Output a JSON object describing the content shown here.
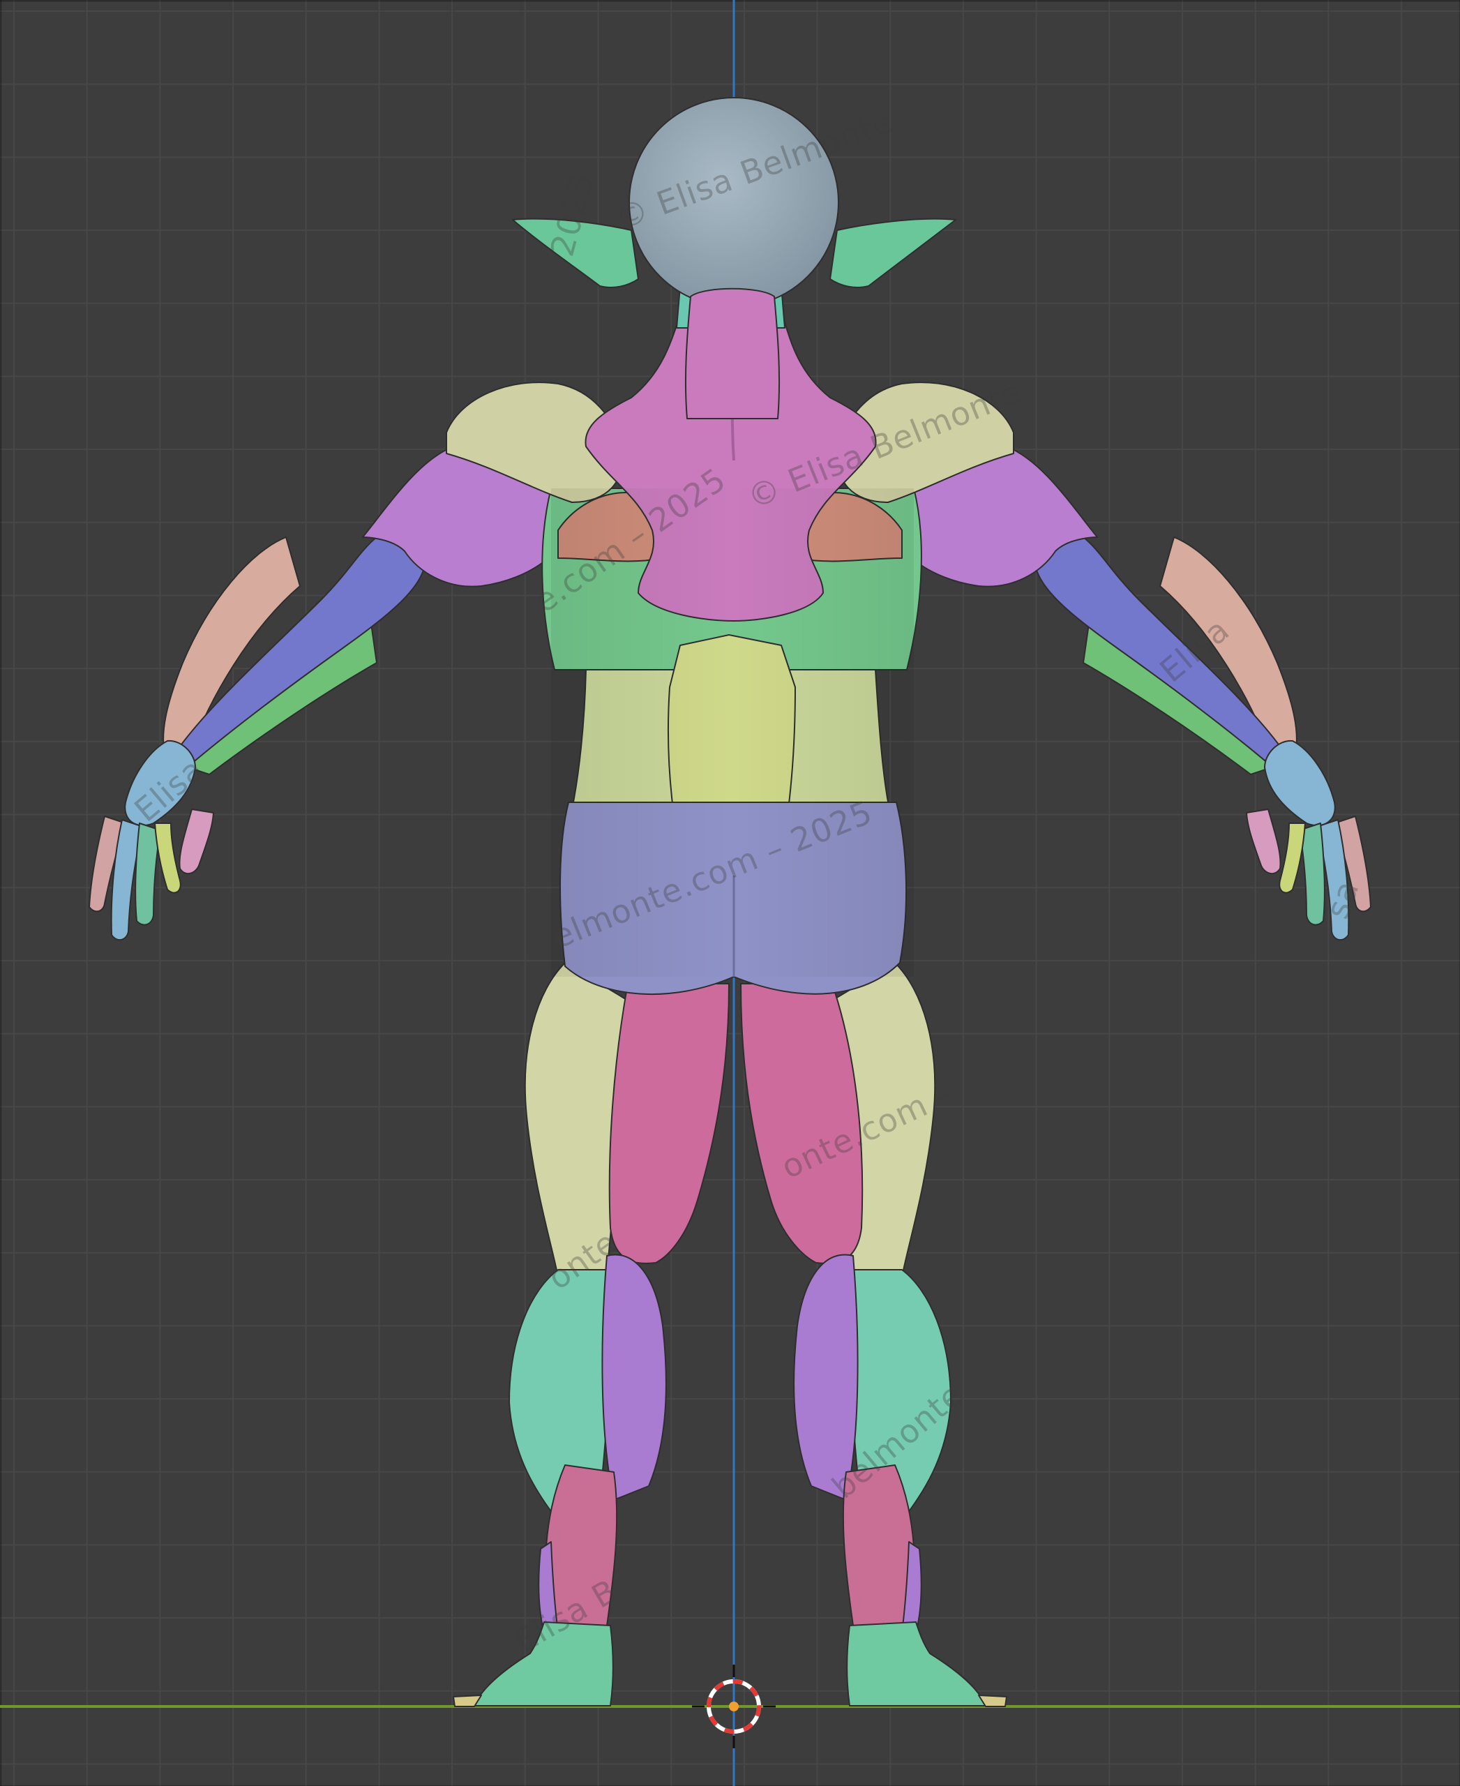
{
  "viewport": {
    "view": "back-orthographic",
    "background_color": "#3d3d3d",
    "grid_color": "#474747",
    "z_axis_color": "#2f77c9",
    "x_axis_color": "#6f9a2a",
    "cursor_colors": [
      "#e53935",
      "#ffffff"
    ]
  },
  "model": {
    "parts": [
      {
        "name": "head",
        "color": "#8fa2b0"
      },
      {
        "name": "ears",
        "color": "#6ac79a"
      },
      {
        "name": "trapezius",
        "color": "#c97bbd"
      },
      {
        "name": "shoulders",
        "color": "#cfd0a3"
      },
      {
        "name": "upper-arms",
        "color": "#b97ecf"
      },
      {
        "name": "forearms",
        "color": "#7478cc"
      },
      {
        "name": "forearm-outer",
        "color": "#d8ab9f"
      },
      {
        "name": "forearm-inner",
        "color": "#6fc177"
      },
      {
        "name": "scapula",
        "color": "#cf8d7a"
      },
      {
        "name": "latissimus",
        "color": "#74c88d"
      },
      {
        "name": "lower-back",
        "color": "#c9d79a"
      },
      {
        "name": "spine-center",
        "color": "#cfd98a"
      },
      {
        "name": "glutes",
        "color": "#8f92c7"
      },
      {
        "name": "outer-thighs",
        "color": "#d2d6a6"
      },
      {
        "name": "hamstrings",
        "color": "#cd6c9c"
      },
      {
        "name": "calves-outer",
        "color": "#76ccb0"
      },
      {
        "name": "calves-inner",
        "color": "#a97cd2"
      },
      {
        "name": "lower-legs",
        "color": "#c96f96"
      },
      {
        "name": "feet",
        "color": "#6fcaa2"
      },
      {
        "name": "hands",
        "color": "#86b6d3"
      }
    ]
  },
  "watermarks": [
    {
      "text": "© Elisa Belmonte"
    },
    {
      "text": "2025"
    },
    {
      "text": "© Elisa Belmonte"
    },
    {
      "text": "e.com – 2025"
    },
    {
      "text": "Elisa"
    },
    {
      "text": "elmonte.com – 2025"
    },
    {
      "text": "Elisa"
    },
    {
      "text": "onte.com –"
    },
    {
      "text": "onte"
    },
    {
      "text": "belmonte"
    },
    {
      "text": "Elisa B"
    },
    {
      "text": "sa"
    }
  ]
}
